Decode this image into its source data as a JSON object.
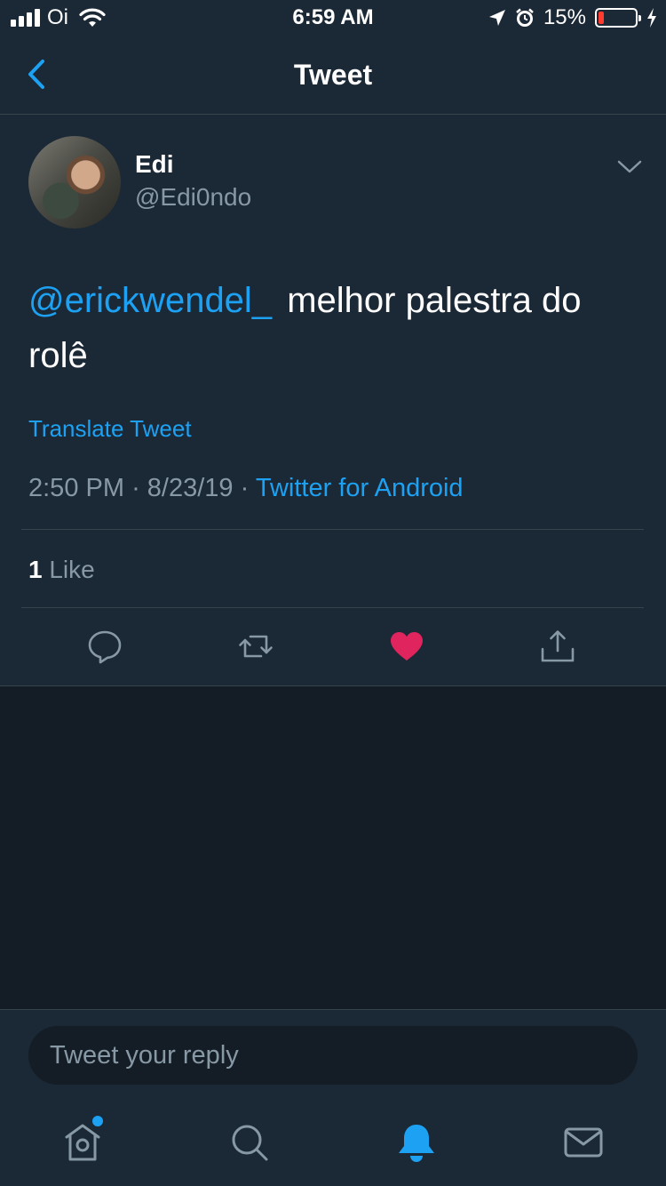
{
  "status_bar": {
    "carrier": "Oi",
    "time": "6:59 AM",
    "battery_percent": "15%",
    "battery_level": 0.15,
    "icons": [
      "signal-icon",
      "wifi-icon",
      "location-arrow-icon",
      "alarm-icon",
      "battery-icon",
      "charging-bolt-icon"
    ]
  },
  "nav": {
    "title": "Tweet",
    "back_icon": "chevron-left-icon"
  },
  "tweet": {
    "author": {
      "display_name": "Edi",
      "handle": "@Edi0ndo"
    },
    "text": {
      "mention": "@erickwendel_",
      "body": "melhor palestra do rolê"
    },
    "translate_label": "Translate Tweet",
    "time": "2:50 PM",
    "separator": "·",
    "date": "8/23/19",
    "source": "Twitter for Android",
    "likes": {
      "count": "1",
      "label": "Like"
    },
    "actions": {
      "reply_icon": "reply-icon",
      "retweet_icon": "retweet-icon",
      "like_icon": "heart-icon",
      "share_icon": "share-icon",
      "liked": true
    }
  },
  "reply": {
    "placeholder": "Tweet your reply"
  },
  "tab_bar": {
    "items": [
      "home-icon",
      "search-icon",
      "notifications-icon",
      "messages-icon"
    ],
    "active": "notifications-icon"
  },
  "colors": {
    "background": "#141d26",
    "surface": "#1b2836",
    "accent": "#1da1f2",
    "muted": "#8899a6",
    "divider": "#38444d",
    "like": "#e0245e",
    "battery_low": "#ff3b30"
  }
}
